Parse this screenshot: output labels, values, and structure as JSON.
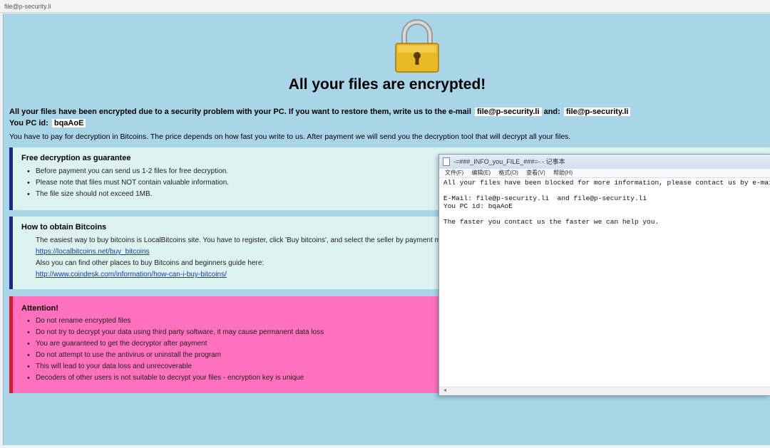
{
  "window": {
    "title": "file@p-security.li"
  },
  "lock_icon": "padlock-icon",
  "headline": "All your files are encrypted!",
  "intro": {
    "line1_text": "All your files have been encrypted due to a security problem with your PC. If you want to restore them, write us to the e-mail",
    "email1": "file@p-security.li",
    "and": "and:",
    "email2": "file@p-security.li",
    "pcid_label": "You PC id:",
    "pcid_value": "bqaAoE",
    "line3": "You have to pay for decryption in Bitcoins. The price depends on how fast you write to us. After payment we will send you the decryption tool that will decrypt all your files."
  },
  "panels": {
    "guarantee": {
      "title": "Free decryption as guarantee",
      "items": [
        "Before payment you can send us 1-2 files for free decryption.",
        "Please note that files must NOT contain valuable information.",
        "The file size should not exceed 1MB."
      ]
    },
    "obtain": {
      "title": "How to obtain Bitcoins",
      "para1": "The easiest way to buy bitcoins is LocalBitcoins site. You have to register, click 'Buy bitcoins', and select the seller by payment method a",
      "link1": "https://localbitcoins.net/buy_bitcoins",
      "para2": "Also you can find other places to buy Bitcoins and beginners guide here:",
      "link2": "http://www.coindesk.com/information/how-can-i-buy-bitcoins/"
    },
    "attention": {
      "title": "Attention!",
      "items": [
        "Do not rename encrypted files",
        "Do not try to decrypt your data using third party software, it may cause permanent data loss",
        "You are guaranteed to get the decryptor after payment",
        "Do not attempt to use the antivirus or uninstall the program",
        "This will lead to your data loss and unrecoverable",
        "Decoders of other users is not suitable to decrypt your files - encryption key is unique"
      ]
    }
  },
  "notepad": {
    "title": "-=###_INFO_you_FILE_###=- - 记事本",
    "menu": [
      "文件(F)",
      "编辑(E)",
      "格式(O)",
      "查看(V)",
      "帮助(H)"
    ],
    "lines": [
      "All your files have been blocked for more information, please contact us by e-mail.",
      "",
      "E-Mail: file@p-security.li  and file@p-security.li",
      "You PC id: bqaAoE",
      "",
      "The faster you contact us the faster we can help you."
    ]
  }
}
